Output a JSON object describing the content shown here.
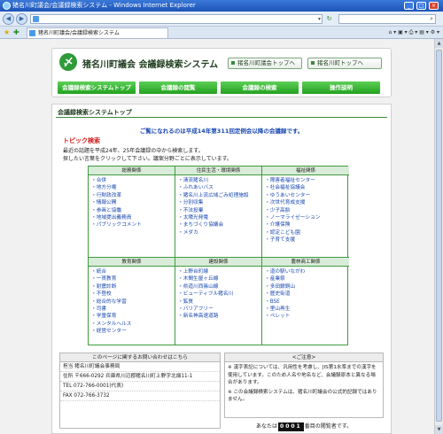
{
  "browser": {
    "window_title": "猪名川町議会/会議録検索システム - Windows Internet Explorer",
    "tab_title": "猪名川町議会/会議録検索システム",
    "minimize": "_",
    "maximize": "□",
    "close": "×"
  },
  "header": {
    "site_title": "猪名川町議会 会議録検索システム",
    "logo_glyph": "〆",
    "top_links": [
      "猪名川町議会トップへ",
      "猪名川町トップへ"
    ],
    "nav": [
      "会議録検索システムトップ",
      "会議録の閲覧",
      "会議録の検索",
      "操作説明"
    ]
  },
  "main": {
    "section_title": "会議録検索システムトップ",
    "notice": "ご覧になれるのは平成14年第311回定例会以降の会議録です。",
    "topic_heading": "トピック検索",
    "topic_line1": "最近の話題を平成24年、25年会議録の中から検索します。",
    "topic_line2": "探したい言葉をクリックして下さい。議案分野ごとに表示しています。"
  },
  "topics": [
    {
      "name": "総務関係",
      "items": [
        "合併",
        "地方分権",
        "行財政改革",
        "情報公開",
        "参画と協働",
        "地域提出義務員",
        "パブリックコメント"
      ]
    },
    {
      "name": "住民生活・環境関係",
      "items": [
        "清流猪名川",
        "ふれあいバス",
        "猪名川上流広域ごみ処理施設",
        "分別収集",
        "不法投棄",
        "太陽光発電",
        "まちづくり協議会",
        "メダカ"
      ]
    },
    {
      "name": "福祉関係",
      "items": [
        "障害者福祉センター",
        "社会福祉協議会",
        "ゆうあいセンター",
        "次世代育成支援",
        "少子高齢",
        "ノーマライゼーション",
        "介護保険",
        "認定こども園",
        "子育て支援"
      ]
    },
    {
      "name": "教育関係",
      "items": [
        "統合",
        "一貫教育",
        "耐震診断",
        "不登校",
        "総合的な学習",
        "司書",
        "学童保育",
        "メンタルヘルス",
        "経営センター"
      ]
    },
    {
      "name": "建設関係",
      "items": [
        "上野台町線",
        "木間生屋ヶ丘線",
        "県道川西篠山線",
        "ビューティフル猪名川",
        "鉱質",
        "バリアフリー",
        "新名神高速道路"
      ]
    },
    {
      "name": "農林商工関係",
      "items": [
        "道の駅いながわ",
        "産業祭",
        "多田銀銅山",
        "歴史街道",
        "BSE",
        "里山再生",
        "ペレット"
      ]
    }
  ],
  "contact": {
    "heading": "このページに関するお問い合わせはこちら",
    "lines": [
      "担当 猪名川町議会事務局",
      "住所 〒666-0292 兵庫県川辺郡猪名川町上野字北畑11-1",
      "TEL 072-766-0001(代表)",
      "FAX 072-766-3732"
    ]
  },
  "caution": {
    "heading": "<ご注意>",
    "p1": "※ 漢字表記については、汎用性を考慮し、JIS第1水準までの漢字を使用しています。このため人名や地名など、会議録原本と異なる場合があります。",
    "p2": "※ この会議録検索システムは、猪名川町議会の公式的記録ではありません。"
  },
  "counter": {
    "prefix": "あなたは",
    "value": "0001",
    "suffix": "番目の閲覧者です。"
  },
  "colors": {
    "accent_green": "#23a11f",
    "link_blue": "#1848b0",
    "topic_red": "#d22020"
  }
}
